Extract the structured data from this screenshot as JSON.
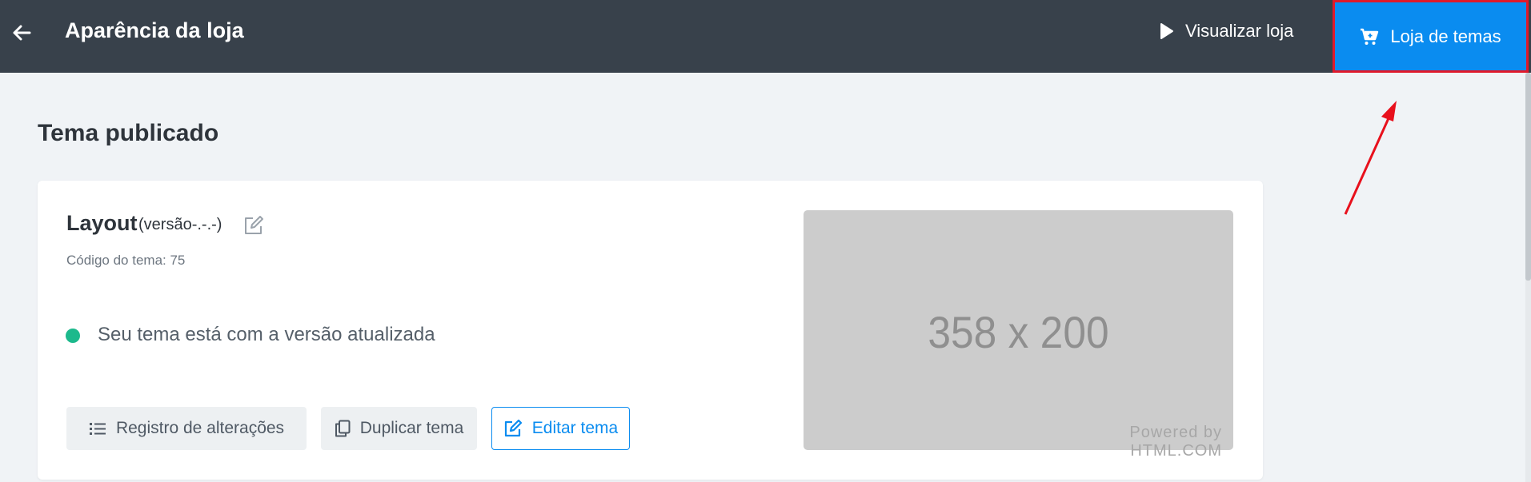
{
  "header": {
    "title": "Aparência da loja",
    "back_icon": "arrow-left-icon",
    "preview_label": "Visualizar loja",
    "preview_icon": "play-icon",
    "theme_store_label": "Loja de temas",
    "theme_store_icon": "cart-icon"
  },
  "main": {
    "section_title": "Tema publicado",
    "card": {
      "name": "Layout",
      "version": "(versão-.-.-)",
      "edit_name_icon": "edit-icon",
      "theme_code": "Código do tema: 75",
      "status_text": "Seu tema está com a versão atualizada",
      "buttons": {
        "changelog_label": "Registro de alterações",
        "changelog_icon": "list-icon",
        "duplicate_label": "Duplicar tema",
        "duplicate_icon": "copy-icon",
        "edit_label": "Editar tema",
        "edit_icon": "edit-icon"
      },
      "thumbnail": {
        "size_text": "358 x 200",
        "powered_text": "Powered by HTML.COM"
      }
    }
  },
  "colors": {
    "header_bg": "#38414b",
    "accent": "#0a8cf0",
    "highlight": "#e0192b",
    "status_ok": "#1cb98c",
    "page_bg": "#f0f3f6"
  }
}
